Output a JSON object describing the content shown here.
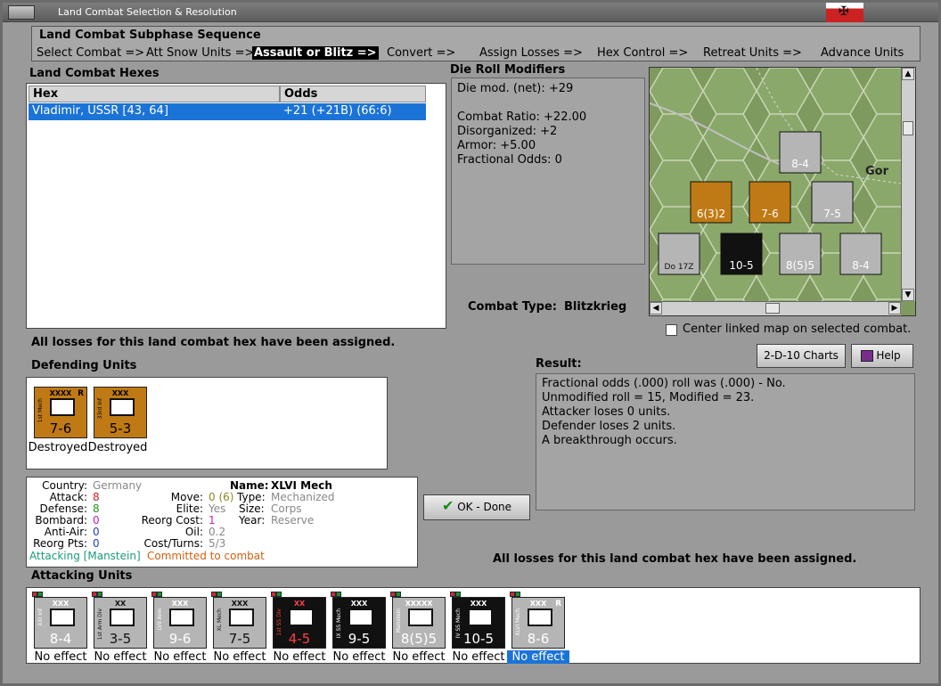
{
  "window": {
    "title": "Land Combat Selection & Resolution"
  },
  "sequence": {
    "title": "Land Combat Subphase Sequence",
    "steps": [
      "Select Combat =>",
      "Att Snow Units =>",
      "Assault or Blitz =>",
      "Convert =>",
      "Assign Losses =>",
      "Hex Control =>",
      "Retreat Units =>",
      "Advance Units"
    ],
    "active_index": 2
  },
  "hexes": {
    "label": "Land Combat Hexes",
    "col_hex": "Hex",
    "col_odds": "Odds",
    "rows": [
      {
        "hex": "Vladimir, USSR [43, 64]",
        "odds": "+21 (+21B) (66:6)"
      }
    ]
  },
  "modifiers": {
    "label": "Die Roll Modifiers",
    "net": "Die mod. (net): +29",
    "lines": [
      "Combat Ratio: +22.00",
      "Disorganized: +2",
      "Armor: +5.00",
      "Fractional Odds: 0"
    ]
  },
  "combat_type": {
    "label": "Combat Type:",
    "value": "Blitzkrieg"
  },
  "map": {
    "city_label": "Gor",
    "center_checkbox_label": "Center linked map on selected combat.",
    "checked": false,
    "counters": [
      {
        "stack": "2",
        "value": "6(3)2",
        "color": "#c07a15"
      },
      {
        "stack": "2",
        "value": "7-6",
        "color": "#c07a15"
      },
      {
        "stack": "",
        "value": "7-5",
        "color": "#b5b5b5"
      },
      {
        "stack": "",
        "value": "8-4",
        "color": "#b5b5b5"
      },
      {
        "stack": "3",
        "value": "10-5",
        "color": "#111"
      },
      {
        "stack": "4",
        "value": "8(5)5",
        "color": "#b5b5b5"
      },
      {
        "stack": "",
        "value": "8-4",
        "color": "#b5b5b5"
      },
      {
        "stack": "3",
        "value": "Do 17Z",
        "color": "#b5b5b5"
      }
    ]
  },
  "status_top": "All losses for this land combat hex have been assigned.",
  "status_bottom": "All losses for this land combat hex have been assigned.",
  "buttons": {
    "charts": "2-D-10 Charts",
    "help": "Help",
    "ok": "OK - Done"
  },
  "defending": {
    "label": "Defending Units",
    "units": [
      {
        "top": "XXXX",
        "side": "1st Mech",
        "value": "7-6",
        "result": "Destroyed",
        "r": "R",
        "color": "#c07a15"
      },
      {
        "top": "XXX",
        "side": "33rd Inf",
        "value": "5-3",
        "result": "Destroyed",
        "r": "",
        "color": "#c07a15"
      }
    ]
  },
  "result": {
    "label": "Result:",
    "lines": [
      "Fractional odds (.000) roll was (.000)  - No.",
      "Unmodified roll = 15, Modified = 23.",
      "Attacker loses 0 units.",
      "Defender loses 2 units.",
      "A breakthrough occurs."
    ]
  },
  "details": {
    "country_label": "Country:",
    "country": "Germany",
    "attack_label": "Attack:",
    "attack": "8",
    "defense_label": "Defense:",
    "defense": "8",
    "bombard_label": "Bombard:",
    "bombard": "0",
    "antiair_label": "Anti-Air:",
    "antiair": "0",
    "reorgpts_label": "Reorg Pts:",
    "reorgpts": "0",
    "move_label": "Move:",
    "move": "0 (6)",
    "elite_label": "Elite:",
    "elite": "Yes",
    "reorgcost_label": "Reorg Cost:",
    "reorgcost": "1",
    "oil_label": "Oil:",
    "oil": "0.2",
    "costturns_label": "Cost/Turns:",
    "costturns": "5/3",
    "name_label": "Name:",
    "name": "XLVI Mech",
    "type_label": "Type:",
    "type": "Mechanized",
    "size_label": "Size:",
    "size": "Corps",
    "year_label": "Year:",
    "year": "Reserve",
    "attacking_note": "Attacking [Manstein]",
    "committed_note": "Committed to combat"
  },
  "attacking": {
    "label": "Attacking Units",
    "units": [
      {
        "top": "XXX",
        "side": "XXI Inf",
        "value": "8-4",
        "result": "No effect",
        "color": "#b5b5b5",
        "fg": "#fff",
        "r": ""
      },
      {
        "top": "XX",
        "side": "1st Arm Div",
        "value": "3-5",
        "result": "No effect",
        "color": "#b5b5b5",
        "fg": "#111",
        "r": ""
      },
      {
        "top": "XXX",
        "side": "LVII Arm",
        "value": "9-6",
        "result": "No effect",
        "color": "#b5b5b5",
        "fg": "#fff",
        "r": ""
      },
      {
        "top": "XXX",
        "side": "XL Mech",
        "value": "7-5",
        "result": "No effect",
        "color": "#b5b5b5",
        "fg": "#111",
        "r": ""
      },
      {
        "top": "XX",
        "side": "1st SS Div",
        "value": "4-5",
        "result": "No effect",
        "color": "#111",
        "fg": "#ff4040",
        "r": ""
      },
      {
        "top": "XXX",
        "side": "IX SS Mech",
        "value": "9-5",
        "result": "No effect",
        "color": "#111",
        "fg": "#fff",
        "r": ""
      },
      {
        "top": "XXXXX",
        "side": "Manstein",
        "value": "8(5)5",
        "result": "No effect",
        "color": "#b5b5b5",
        "fg": "#fff",
        "r": ""
      },
      {
        "top": "XXX",
        "side": "IV SS Mech",
        "value": "10-5",
        "result": "No effect",
        "color": "#111",
        "fg": "#fff",
        "r": ""
      },
      {
        "top": "XXX",
        "side": "XLVI Mech",
        "value": "8-6",
        "result": "No effect",
        "color": "#b5b5b5",
        "fg": "#fff",
        "r": "R"
      }
    ]
  }
}
